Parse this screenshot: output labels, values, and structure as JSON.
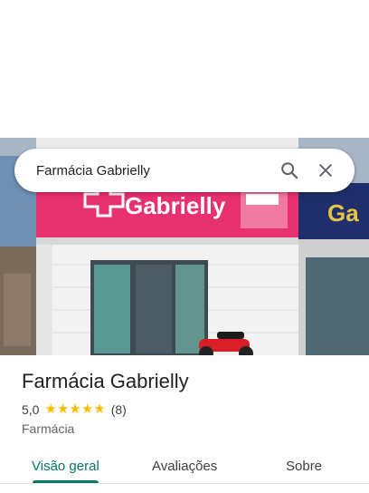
{
  "search": {
    "query": "Farmácia Gabrielly"
  },
  "photo": {
    "sign_text": "Gabrielly",
    "neighbor_sign_text": "Ga"
  },
  "place": {
    "name": "Farmácia Gabrielly",
    "rating": "5,0",
    "stars": 5,
    "review_count": "(8)",
    "category": "Farmácia"
  },
  "tabs": [
    {
      "label": "Visão geral",
      "active": true
    },
    {
      "label": "Avaliações",
      "active": false
    },
    {
      "label": "Sobre",
      "active": false
    }
  ],
  "colors": {
    "accent": "#00796b",
    "star": "#fbbc04",
    "sign_pink": "#e8306e"
  },
  "icons": {
    "search": "search-icon",
    "close": "close-icon"
  }
}
